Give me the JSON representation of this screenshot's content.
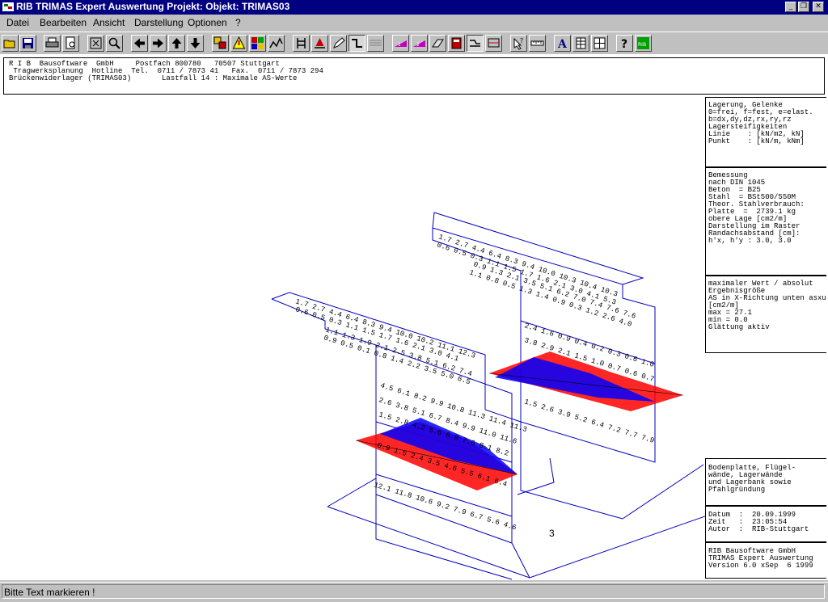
{
  "window": {
    "title": "RIB TRIMAS Expert Auswertung  Projekt:     Objekt: TRIMAS03",
    "minimize": "_",
    "restore": "❐",
    "close": "✕"
  },
  "menu": {
    "datei": "Datei",
    "bearbeiten": "Bearbeiten",
    "ansicht": "Ansicht",
    "darstellung": "Darstellung",
    "optionen": "Optionen",
    "help": "?"
  },
  "toolbar": {
    "icons": [
      "open-icon",
      "save-icon",
      "print-icon",
      "print-preview-icon",
      "zoom-fit-icon",
      "zoom-icon",
      "arrow-left-icon",
      "arrow-right-icon",
      "arrow-up-icon",
      "arrow-down-icon",
      "layers-icon",
      "warning-icon",
      "colors-icon",
      "graph-icon",
      "support-icon",
      "load-icon",
      "edit-icon",
      "step-icon",
      "grid-icon",
      "result-1-icon",
      "result-2-icon",
      "section-icon",
      "book-icon",
      "cut-icon",
      "select-icon",
      "query-icon",
      "ruler-icon",
      "text-icon",
      "table-icon",
      "matrix-icon",
      "help-icon",
      "rib-icon"
    ]
  },
  "header": {
    "line1": "R I B  Bausoftware  GmbH     Postfach 800780   70507 Stuttgart",
    "line2": " Tragwerksplanung  Hotline  Tel.  0711 / 7873 41   Fax.  0711 / 7873 294",
    "line3": "Brückenwiderlager (TRIMAS03)       Lastfall 14 : Maximale AS-Werte"
  },
  "legend_box1": [
    "Lagerung, Gelenke",
    "0=frei, f=fest, e=elast.",
    "b=dx,dy,dz,rx,ry,rz",
    "Lagersteifigkeiten",
    "Linie    : [kN/m2, kN]",
    "Punkt    : [kN/m, kNm]"
  ],
  "legend_box2": [
    "Bemessung",
    "nach DIN 1045",
    "Beton  = B25",
    "Stahl  = BSt500/550M",
    "Theor. Stahlverbrauch:",
    "Platte  =  2739.1 kg",
    "obere Lage [cm2/m]",
    "Darstellung im Raster",
    "Randachsabstand [cm]:",
    "h'x, h'y : 3.0, 3.0"
  ],
  "legend_box3": [
    "maximaler Wert / absolut",
    "Ergebnisgröße",
    "AS in X-Richtung unten asxu",
    "[cm2/m]",
    "max = 27.1",
    "min = 0.0",
    "Glättung aktiv"
  ],
  "legend_box4": [
    "Bodenplatte, Flügel-",
    "wände, Lagerwände",
    "und Lagerbank sowie",
    "Pfahlgründung"
  ],
  "legend_box5": [
    "Datum  :  20.09.1999",
    "Zeit   :  23:05:54",
    "Autor  :  RIB-Stuttgart"
  ],
  "legend_box6": [
    "RIB Bausoftware GmbH",
    "TRIMAS Expert Auswertung",
    "Version 6.0 xSep  6 1999"
  ],
  "model": {
    "node_label": "3",
    "value_rows": [
      "1.7 2.7 4.4 6.4 8.3 9.4 10.0 10.3 10.4 10.3",
      "0.6 0.5 0.3 1.1 1.5 1.7 1.6 2.1 3.0 4.1 5.3",
      "0.9 1.3 2.1 3.5 5.1 6.2 7.0 7.4 7.6 7.6",
      "1.1 0.8 0.5 1.3 1.4 0.9 0.3 1.2 2.6 4.0",
      "1.7 2.7 4.4 6.4 8.3 9.4 10.0 10.2 11.1 12.3",
      "0.6 0.5 0.3 1.1 1.5 1.7 1.6 2.1 3.0 4.1",
      "1.1 1.3 1.9 2.1 2.5 3.8 5.1 6.2 7.4",
      "0.9 0.5 0.1 0.8 1.4 2.2 3.5 5.0 6.5",
      "4.5 6.1 8.2 9.9 10.8 11.3 11.4 11.3",
      "2.6 3.8 5.1 6.7 8.4 9.9 11.0 11.6",
      "1.5 2.8 4.2 5.6 6.8 7.6 8.1 8.2",
      "0.9 1.5 2.4 3.5 4.6 5.5 6.1 6.4",
      "2.4 1.6 0.9 0.4 0.2 0.3 0.6 1.0",
      "3.8 2.9 2.1 1.5 1.0 0.7 0.6 0.7",
      "1.5 2.6 3.9 5.2 6.4 7.2 7.7 7.9",
      "12.1 11.8 10.6 9.2 7.9 6.7 5.6 4.6"
    ]
  },
  "status": {
    "text": "Bitte Text markieren !"
  }
}
